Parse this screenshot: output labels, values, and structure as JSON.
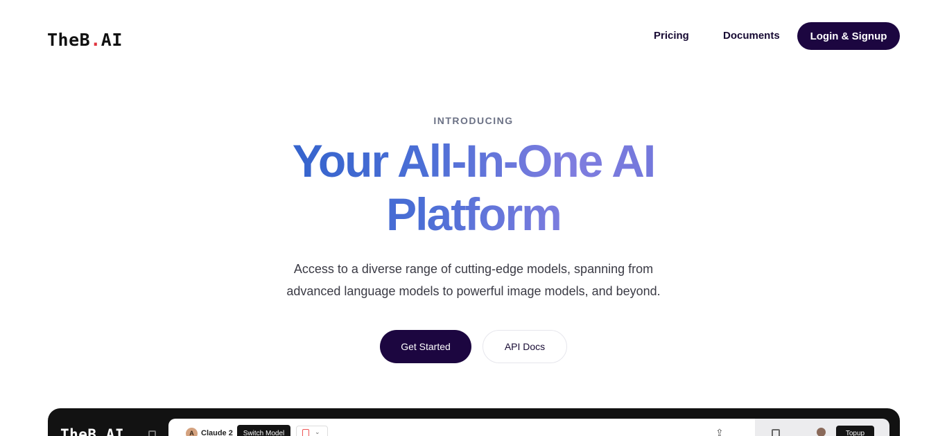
{
  "nav": {
    "logo_main": "TheB",
    "logo_dot": ".",
    "logo_suffix": "AI",
    "links": {
      "pricing": "Pricing",
      "documents": "Documents"
    },
    "login_label": "Login & Signup"
  },
  "hero": {
    "eyebrow": "INTRODUCING",
    "headline": "Your All-In-One AI Platform",
    "subtitle": "Access to a diverse range of cutting-edge models, spanning from advanced language models to powerful image models, and beyond.",
    "primary_cta": "Get Started",
    "secondary_cta": "API Docs"
  },
  "preview": {
    "logo": "TheB.AI",
    "model_avatar": "A",
    "model_name": "Claude 2",
    "switch_model_label": "Switch Model",
    "topup_label": "Topup"
  },
  "colors": {
    "brand_dark": "#1c0640",
    "logo_dot": "#e0353f",
    "headline_gradient_start": "#2a5ec8",
    "headline_gradient_end": "#7f7ddf"
  },
  "icons": [
    "sidebar-toggle-icon",
    "file-icon",
    "chevron-down-icon",
    "share-icon",
    "panel-icon",
    "user-avatar-icon"
  ]
}
